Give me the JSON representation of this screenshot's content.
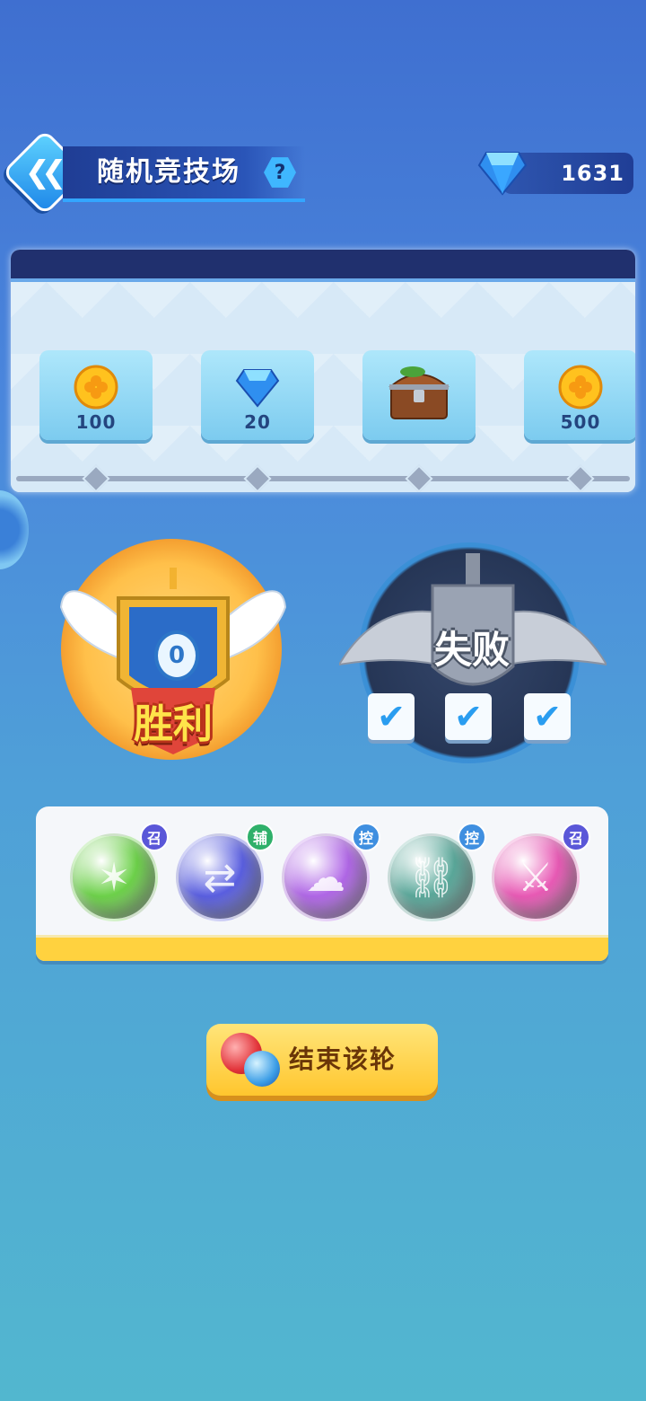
{
  "header": {
    "title": "随机竞技场",
    "help_label": "?",
    "gems": "1631"
  },
  "rewards": [
    {
      "milestone": "1",
      "amount": "100",
      "icon": "gold-coin-icon"
    },
    {
      "milestone": "2",
      "amount": "20",
      "icon": "diamond-icon"
    },
    {
      "milestone": "3",
      "amount": "",
      "icon": "treasure-chest-icon"
    },
    {
      "milestone": "4",
      "amount": "500",
      "icon": "gold-coin-icon"
    }
  ],
  "results": {
    "win_label": "胜利",
    "win_count": "0",
    "lose_label": "失败",
    "loss_checks_filled": 3,
    "loss_checks_total": 3
  },
  "skills": [
    {
      "tag": "召",
      "color": "#6dd14a",
      "tag_color": "#5a57d8",
      "icon": "star-seal-icon"
    },
    {
      "tag": "辅",
      "color": "#5a5fe0",
      "tag_color": "#2fb06a",
      "icon": "swap-arrows-icon"
    },
    {
      "tag": "控",
      "color": "#b067e6",
      "tag_color": "#3f8fe0",
      "icon": "cloud-icon"
    },
    {
      "tag": "控",
      "color": "#5aa89a",
      "tag_color": "#3f8fe0",
      "icon": "chain-icon"
    },
    {
      "tag": "召",
      "color": "#e85ab5",
      "tag_color": "#5a57d8",
      "icon": "sword-icon"
    }
  ],
  "end_button": {
    "label": "结束该轮"
  },
  "colors": {
    "accent": "#3fb7ff",
    "gold": "#ffd23f"
  }
}
